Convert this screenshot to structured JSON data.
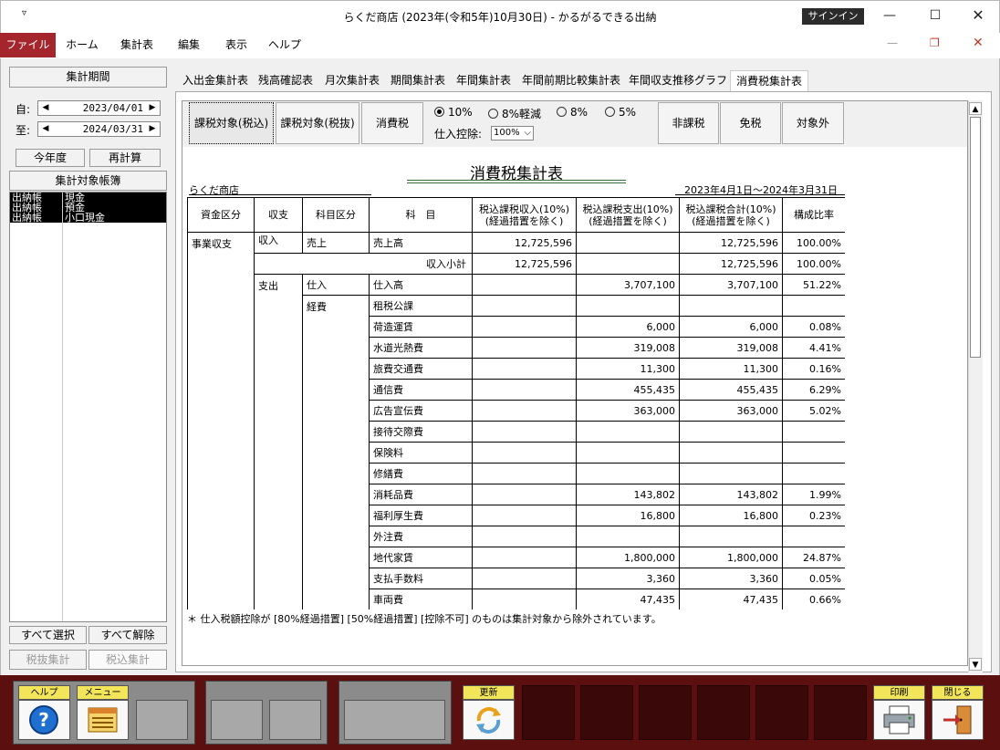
{
  "window": {
    "title": "らくだ商店 (2023年(令和5年)10月30日)  -  かるがるできる出納",
    "signin": "サインイン"
  },
  "menu": [
    "ファイル",
    "ホーム",
    "集計表",
    "編集",
    "表示",
    "ヘルプ"
  ],
  "sidebar": {
    "period_header": "集計期間",
    "from_label": "自:",
    "to_label": "至:",
    "from_date": "2023/04/01",
    "to_date": "2024/03/31",
    "this_year": "今年度",
    "recalc": "再計算",
    "books_header": "集計対象帳簿",
    "accounts": [
      {
        "book": "出納帳",
        "name": "現金"
      },
      {
        "book": "出納帳",
        "name": "預金"
      },
      {
        "book": "出納帳",
        "name": "小口現金"
      }
    ],
    "select_all": "すべて選択",
    "deselect_all": "すべて解除",
    "tax_excl": "税抜集計",
    "tax_incl": "税込集計"
  },
  "tabs": [
    "入出金集計表",
    "残高確認表",
    "月次集計表",
    "期間集計表",
    "年間集計表",
    "年間前期比較集計表",
    "年間収支推移グラフ",
    "消費税集計表"
  ],
  "toolbar": {
    "btn_incl": "課税対象(税込)",
    "btn_excl": "課税対象(税抜)",
    "btn_tax": "消費税",
    "rates": [
      "10%",
      "8%軽減",
      "8%",
      "5%"
    ],
    "deduction_label": "仕入控除:",
    "deduction_value": "100%",
    "btn_nontax": "非課税",
    "btn_exempt": "免税",
    "btn_outside": "対象外"
  },
  "report": {
    "title": "消費税集計表",
    "company": "らくだ商店",
    "period": "2023年4月1日～2024年3月31日",
    "headers": [
      "資金区分",
      "収支",
      "科目区分",
      "科　目",
      "税込課税収入(10%)\n(経過措置を除く)",
      "税込課税支出(10%)\n(経過措置を除く)",
      "税込課税合計(10%)\n(経過措置を除く)",
      "構成比率"
    ],
    "fund": "事業収支",
    "income": "収入",
    "expense": "支出",
    "cat_sales": "売上",
    "cat_purchase": "仕入",
    "cat_expenses": "経費",
    "rows": [
      {
        "name": "売上高",
        "inc": "12,725,596",
        "exp": "",
        "total": "12,725,596",
        "ratio": "100.00%"
      },
      {
        "name": "収入小計",
        "inc": "12,725,596",
        "exp": "",
        "total": "12,725,596",
        "ratio": "100.00%"
      },
      {
        "name": "仕入高",
        "inc": "",
        "exp": "3,707,100",
        "total": "3,707,100",
        "ratio": "51.22%"
      },
      {
        "name": "租税公課",
        "inc": "",
        "exp": "",
        "total": "",
        "ratio": ""
      },
      {
        "name": "荷造運賃",
        "inc": "",
        "exp": "6,000",
        "total": "6,000",
        "ratio": "0.08%"
      },
      {
        "name": "水道光熱費",
        "inc": "",
        "exp": "319,008",
        "total": "319,008",
        "ratio": "4.41%"
      },
      {
        "name": "旅費交通費",
        "inc": "",
        "exp": "11,300",
        "total": "11,300",
        "ratio": "0.16%"
      },
      {
        "name": "通信費",
        "inc": "",
        "exp": "455,435",
        "total": "455,435",
        "ratio": "6.29%"
      },
      {
        "name": "広告宣伝費",
        "inc": "",
        "exp": "363,000",
        "total": "363,000",
        "ratio": "5.02%"
      },
      {
        "name": "接待交際費",
        "inc": "",
        "exp": "",
        "total": "",
        "ratio": ""
      },
      {
        "name": "保険料",
        "inc": "",
        "exp": "",
        "total": "",
        "ratio": ""
      },
      {
        "name": "修繕費",
        "inc": "",
        "exp": "",
        "total": "",
        "ratio": ""
      },
      {
        "name": "消耗品費",
        "inc": "",
        "exp": "143,802",
        "total": "143,802",
        "ratio": "1.99%"
      },
      {
        "name": "福利厚生費",
        "inc": "",
        "exp": "16,800",
        "total": "16,800",
        "ratio": "0.23%"
      },
      {
        "name": "外注費",
        "inc": "",
        "exp": "",
        "total": "",
        "ratio": ""
      },
      {
        "name": "地代家賃",
        "inc": "",
        "exp": "1,800,000",
        "total": "1,800,000",
        "ratio": "24.87%"
      },
      {
        "name": "支払手数料",
        "inc": "",
        "exp": "3,360",
        "total": "3,360",
        "ratio": "0.05%"
      },
      {
        "name": "車両費",
        "inc": "",
        "exp": "47,435",
        "total": "47,435",
        "ratio": "0.66%"
      }
    ],
    "footnote": "＊ 仕入税額控除が [80%経過措置] [50%経過措置] [控除不可] のものは集計対象から除外されています。"
  },
  "bottom": {
    "help": "ヘルプ",
    "menu": "メニュー",
    "update": "更新",
    "print": "印刷",
    "close": "閉じる"
  },
  "colors": {
    "file_menu": "#a4262c",
    "bottom_bar": "#5c0f0f",
    "label_yellow": "#f2e55a"
  }
}
